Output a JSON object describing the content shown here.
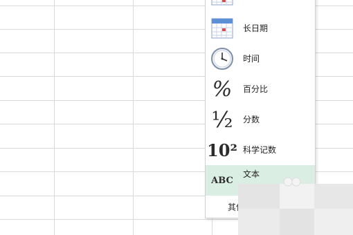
{
  "menu": {
    "items": [
      {
        "label": "",
        "icon": "calendar-icon"
      },
      {
        "label": "长日期",
        "icon": "calendar-icon"
      },
      {
        "label": "时间",
        "icon": "clock-icon"
      },
      {
        "label": "百分比",
        "icon": "percent-icon",
        "symbol": "%"
      },
      {
        "label": "分数",
        "icon": "fraction-icon",
        "symbol": "½"
      },
      {
        "label": "科学记数",
        "icon": "scientific-icon",
        "symbol": "10²"
      },
      {
        "label": "文本",
        "icon": "text-icon",
        "symbol": "ABC"
      }
    ],
    "footer_label": "其他"
  },
  "colors": {
    "active_item_bg": "#dbeee3",
    "grid_line": "#d9d9d9",
    "calendar_header": "#5b8fd6"
  }
}
